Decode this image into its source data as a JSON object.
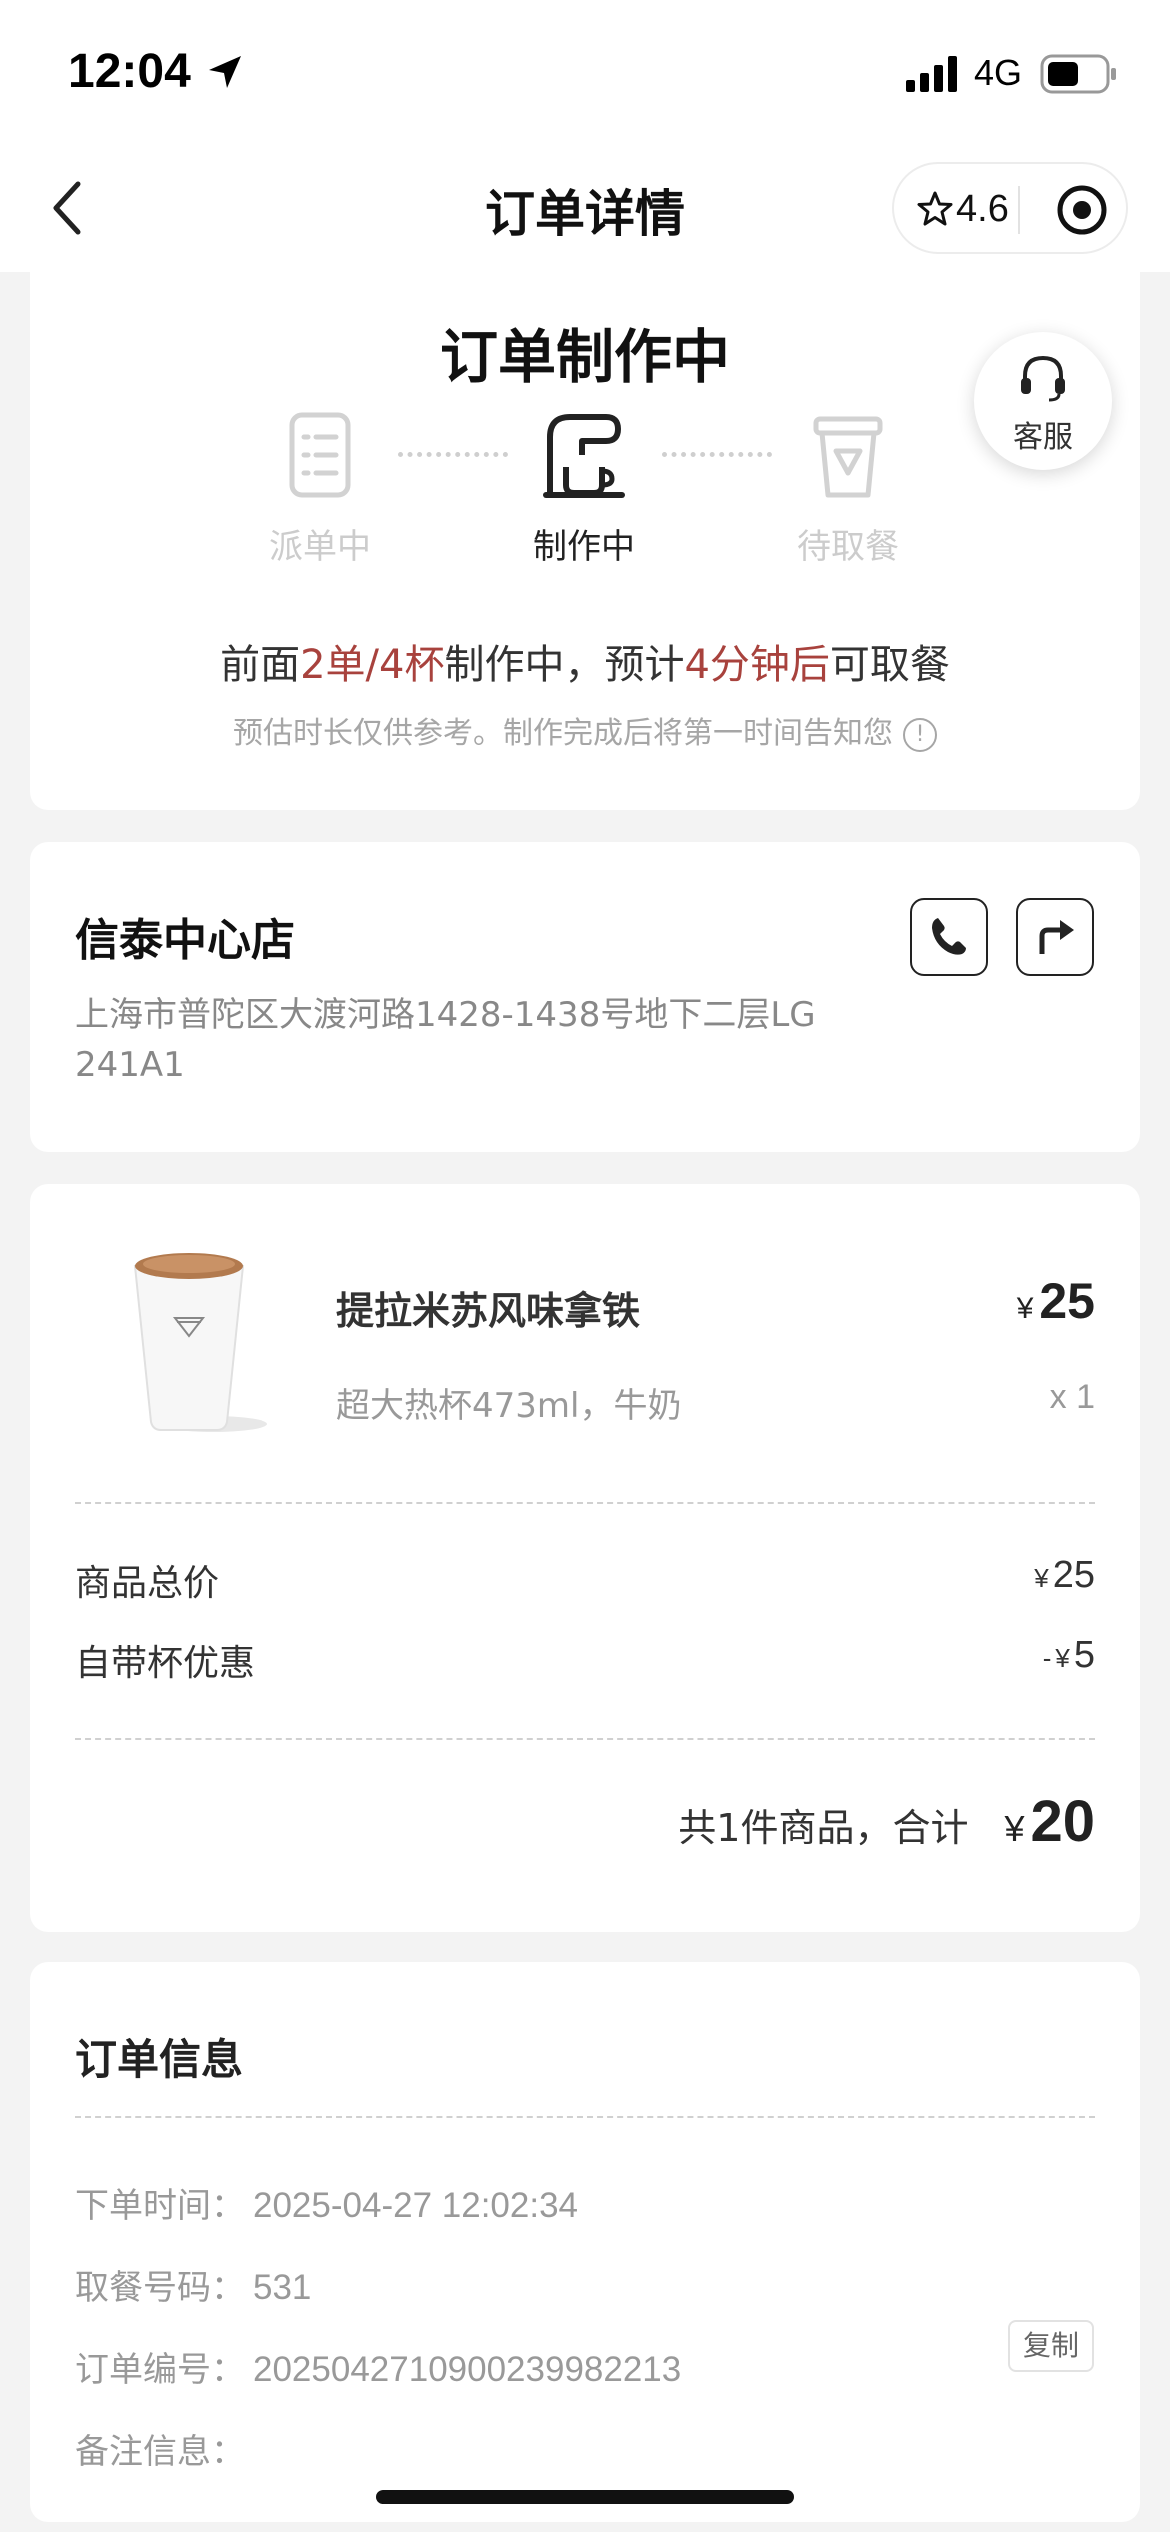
{
  "status_bar": {
    "time": "12:04",
    "network": "4G",
    "icons": [
      "location-arrow-icon",
      "signal-icon",
      "battery-icon"
    ]
  },
  "nav": {
    "title": "订单详情",
    "rating": "4.6",
    "icons": [
      "back-arrow-icon",
      "star-icon",
      "target-icon"
    ]
  },
  "progress": {
    "title": "订单制作中",
    "steps": [
      {
        "label": "派单中",
        "icon": "list-icon",
        "active": false
      },
      {
        "label": "制作中",
        "icon": "coffee-machine-icon",
        "active": true
      },
      {
        "label": "待取餐",
        "icon": "cup-icon",
        "active": false
      }
    ],
    "customer_service": "客服",
    "message": {
      "prefix": "前面",
      "queue": "2单/4杯",
      "middle": "制作中，预计",
      "eta": "4分钟后",
      "suffix": "可取餐"
    },
    "note": "预估时长仅供参考。制作完成后将第一时间告知您",
    "highlight_color": "#a8423d"
  },
  "store": {
    "name": "信泰中心店",
    "address": "上海市普陀区大渡河路1428-1438号地下二层LG 241A1",
    "icons": [
      "phone-icon",
      "navigation-icon"
    ]
  },
  "order": {
    "product": {
      "name": "提拉米苏风味拿铁",
      "currency": "¥",
      "price": "25",
      "spec": "超大热杯473ml，牛奶",
      "qty": "x 1"
    },
    "subtotal": {
      "label": "商品总价",
      "currency": "¥",
      "value": "25"
    },
    "discount": {
      "label": "自带杯优惠",
      "prefix": "-",
      "currency": "¥",
      "value": "5"
    },
    "total": {
      "label": "共1件商品，合计",
      "currency": "¥",
      "value": "20"
    }
  },
  "info": {
    "title": "订单信息",
    "rows": [
      {
        "label": "下单时间：",
        "value": "2025-04-27 12:02:34"
      },
      {
        "label": "取餐号码：",
        "value": "531"
      },
      {
        "label": "订单编号：",
        "value": "2025042710900239982213"
      },
      {
        "label": "备注信息：",
        "value": ""
      }
    ],
    "copy_label": "复制"
  }
}
